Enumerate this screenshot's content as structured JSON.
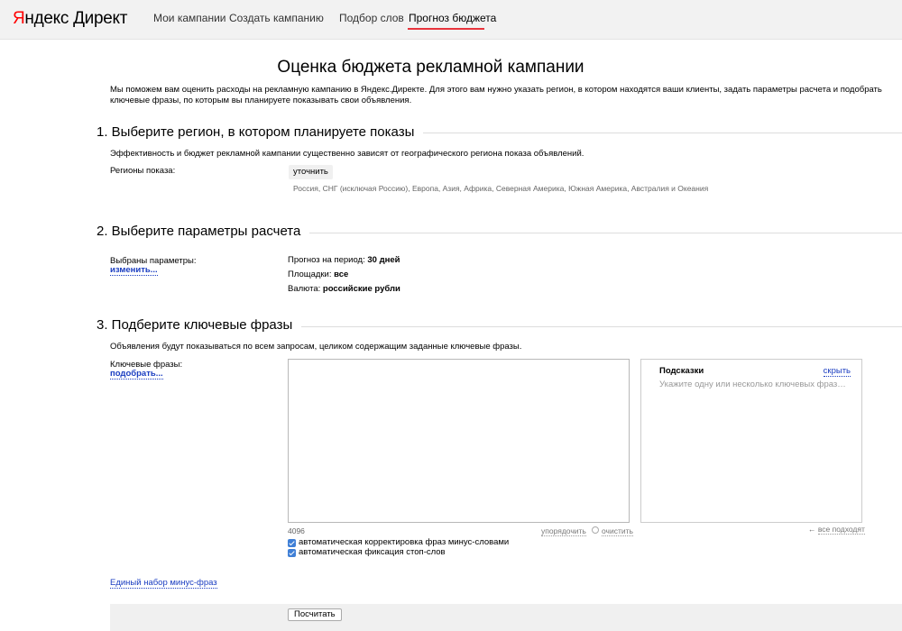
{
  "header": {
    "logo_brand_first": "Я",
    "logo_brand_rest": "ндекс",
    "logo_product": "Директ",
    "nav": [
      {
        "label": "Мои кампании"
      },
      {
        "label": "Создать кампанию"
      },
      {
        "label": "Подбор слов"
      },
      {
        "label": "Прогноз бюджета",
        "active": true
      }
    ],
    "accent_color": "#e8343c"
  },
  "page": {
    "title": "Оценка бюджета рекламной кампании",
    "intro": "Мы поможем вам оценить расходы на рекламную кампанию в Яндекс.Директе. Для этого вам нужно указать регион, в котором находятся ваши клиенты, задать параметры расчета и подобрать ключевые фразы, по которым вы планируете показывать свои объявления."
  },
  "section1": {
    "title": "1. Выберите регион, в котором планируете показы",
    "desc": "Эффективность и бюджет рекламной кампании существенно зависят от географического региона показа объявлений.",
    "regions_label": "Регионы показа:",
    "refine_button": "уточнить",
    "regions_value": "Россия, СНГ (исключая Россию), Европа, Азия, Африка, Северная Америка, Южная Америка, Австралия и Океания"
  },
  "section2": {
    "title": "2. Выберите параметры расчета",
    "params_label": "Выбраны параметры:",
    "change_link": "изменить...",
    "period_label": "Прогноз на период:",
    "period_value": "30 дней",
    "platforms_label": "Площадки:",
    "platforms_value": "все",
    "currency_label": "Валюта:",
    "currency_value": "российские рубли"
  },
  "section3": {
    "title": "3. Подберите ключевые фразы",
    "desc": "Объявления будут показываться по всем запросам, целиком содержащим заданные ключевые фразы.",
    "keywords_label": "Ключевые фразы:",
    "pick_link": "подобрать...",
    "textarea_value": "",
    "char_counter": "4096",
    "order_link": "упорядочить",
    "clear_link": "очистить",
    "tips_title": "Подсказки",
    "tips_hide": "скрыть",
    "tips_placeholder": "Укажите одну или несколько ключевых фраз…",
    "all_fit_link": "все подходят",
    "checkbox_auto_correct": "автоматическая корректировка фраз минус-словами",
    "checkbox_auto_correct_checked": true,
    "checkbox_stopwords": "автоматическая фиксация стоп-слов",
    "checkbox_stopwords_checked": true,
    "minus_phrases_link": "Единый набор минус-фраз",
    "submit_button": "Посчитать"
  }
}
